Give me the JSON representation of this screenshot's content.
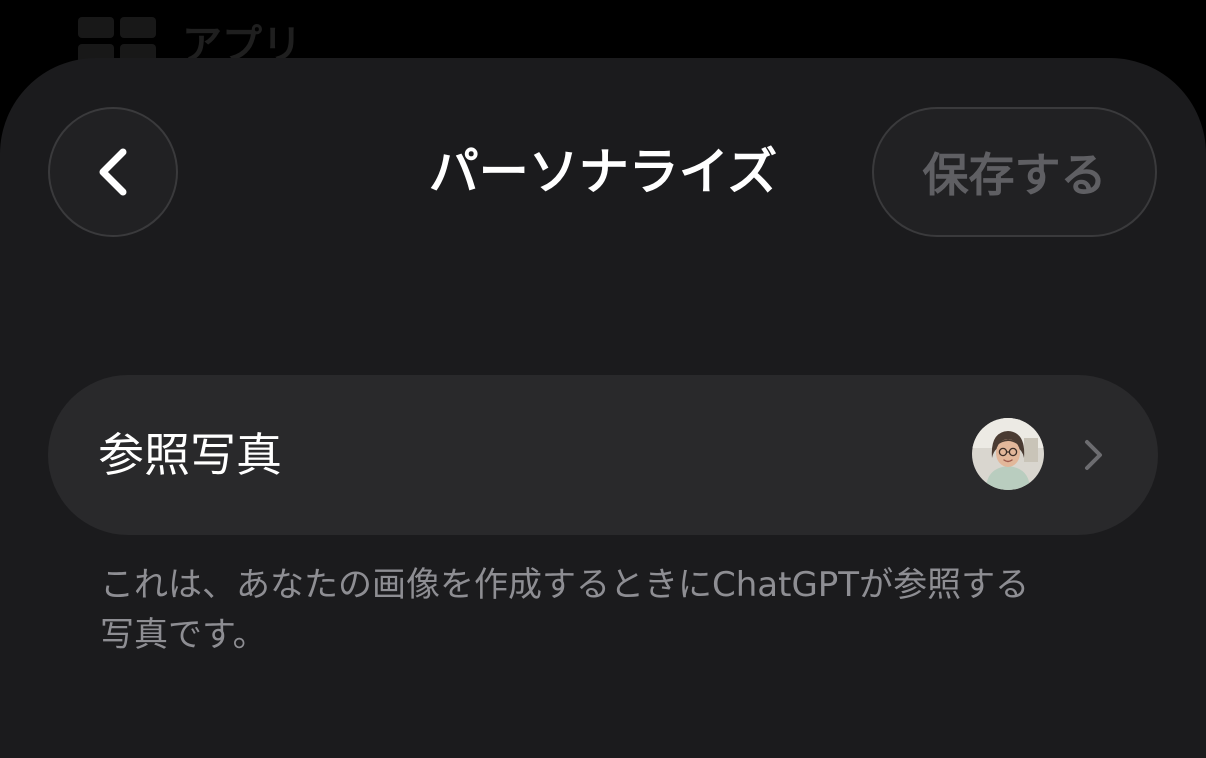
{
  "background_app": {
    "label": "アプリ"
  },
  "header": {
    "title": "パーソナライズ",
    "save_label": "保存する"
  },
  "reference_photo": {
    "label": "参照写真",
    "description": "これは、あなたの画像を作成するときにChatGPTが参照する写真です。"
  },
  "icons": {
    "back": "chevron-left-icon",
    "row_chevron": "chevron-right-icon",
    "avatar": "avatar-photo"
  },
  "colors": {
    "sheet": "#1b1b1d",
    "row": "#29292b",
    "button": "#212123",
    "disabled_text": "#5f5f63",
    "secondary_text": "#8e8e93"
  }
}
